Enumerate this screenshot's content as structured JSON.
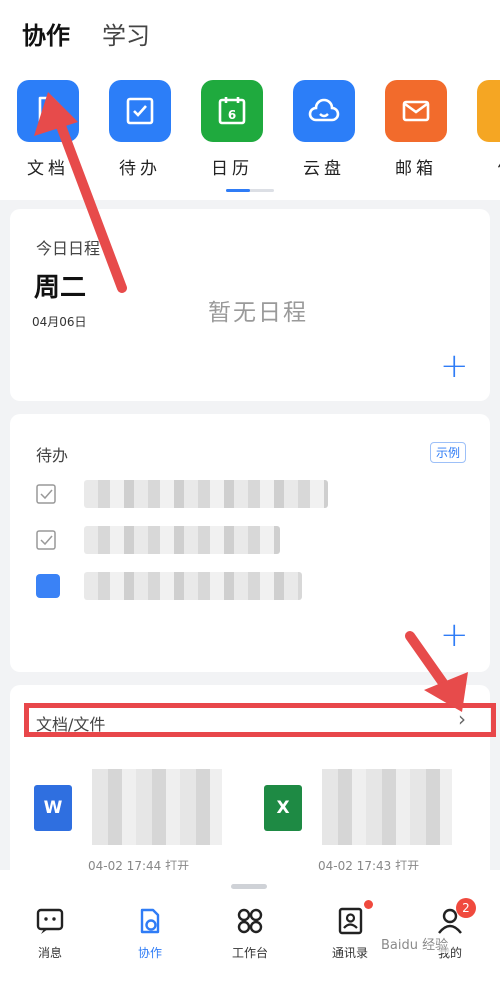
{
  "top_tabs": [
    {
      "label": "协作"
    },
    {
      "label": "学习"
    }
  ],
  "apps": [
    {
      "label": "文档",
      "icon": "doc-icon",
      "color": "#2c7ef8"
    },
    {
      "label": "待办",
      "icon": "todo-check-icon",
      "color": "#2c7ef8"
    },
    {
      "label": "日历",
      "icon": "calendar-icon",
      "color": "#1faa3e",
      "day": "6"
    },
    {
      "label": "云盘",
      "icon": "cloud-icon",
      "color": "#2c7ef8"
    },
    {
      "label": "邮箱",
      "icon": "mail-icon",
      "color": "#f26b2c"
    },
    {
      "label": "便",
      "icon": "note-icon",
      "color": "#f5a623"
    }
  ],
  "calendar": {
    "title": "今日日程",
    "weekday": "周二",
    "date": "04月06日",
    "empty": "暂无日程"
  },
  "todo": {
    "title": "待办",
    "example": "示例"
  },
  "docs": {
    "title": "文档/文件",
    "files": [
      {
        "icon": "W",
        "meta": "04-02 17:44 打开",
        "color": "#2f6fe0"
      },
      {
        "icon": "X",
        "meta": "04-02 17:43 打开",
        "color": "#1e8a44"
      }
    ]
  },
  "bottom_nav": [
    {
      "label": "消息",
      "icon": "message-icon"
    },
    {
      "label": "协作",
      "icon": "collab-icon"
    },
    {
      "label": "工作台",
      "icon": "workbench-icon"
    },
    {
      "label": "通讯录",
      "icon": "contacts-icon"
    },
    {
      "label": "我的",
      "icon": "profile-icon",
      "badge": "2"
    }
  ],
  "watermark": "Baidu 经验"
}
